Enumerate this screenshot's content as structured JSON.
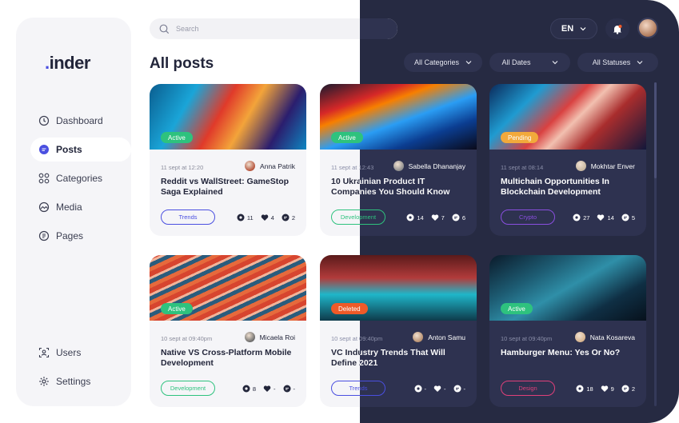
{
  "logo": {
    "dot": ".",
    "text": "inder"
  },
  "search": {
    "placeholder": "Search"
  },
  "language": "EN",
  "page_title": "All posts",
  "filters": [
    "All Categories",
    "All Dates",
    "All Statuses"
  ],
  "nav": [
    {
      "label": "Dashboard",
      "icon": "clock-icon"
    },
    {
      "label": "Posts",
      "icon": "posts-icon"
    },
    {
      "label": "Categories",
      "icon": "categories-icon"
    },
    {
      "label": "Media",
      "icon": "media-icon"
    },
    {
      "label": "Pages",
      "icon": "pages-icon"
    },
    {
      "label": "Users",
      "icon": "users-icon"
    },
    {
      "label": "Settings",
      "icon": "gear-icon"
    }
  ],
  "active_nav": "Posts",
  "colors": {
    "accent": "#4a4fe0",
    "active": "#2ec27e",
    "pending": "#f2a93b",
    "deleted": "#f05a28",
    "dark_bg": "#262a42"
  },
  "posts": [
    {
      "status": "Active",
      "date": "11 sept at 12:20",
      "author": "Anna Patrik",
      "title": "Reddit vs WallStreet: GameStop Saga Explained",
      "category": "Trends",
      "views": "11",
      "likes": "4",
      "comments": "2"
    },
    {
      "status": "Active",
      "date": "11 sept at 12:43",
      "author": "Sabella Dhananjay",
      "title": "10 Ukrainian Product IT Companies You Should Know",
      "category": "Development",
      "views": "14",
      "likes": "7",
      "comments": "6"
    },
    {
      "status": "Pending",
      "date": "11 sept at 08:14",
      "author": "Mokhtar Enver",
      "title": "Multichain Opportunities In Blockchain Development",
      "category": "Crypto",
      "views": "27",
      "likes": "14",
      "comments": "5"
    },
    {
      "status": "Active",
      "date": "10 sept at 09:40pm",
      "author": "Micaela Roi",
      "title": "Native VS Cross-Platform Mobile Development",
      "category": "Development",
      "views": "8",
      "likes": "-",
      "comments": "-"
    },
    {
      "status": "Deleted",
      "date": "10 sept at 09:40pm",
      "author": "Anton Samu",
      "title": "VC Industry Trends That Will Define 2021",
      "category": "Trends",
      "views": "-",
      "likes": "-",
      "comments": "-"
    },
    {
      "status": "Active",
      "date": "10 sept at 09:40pm",
      "author": "Nata Kosareva",
      "title": "Hamburger Menu: Yes Or No?",
      "category": "Design",
      "views": "18",
      "likes": "9",
      "comments": "2"
    }
  ]
}
